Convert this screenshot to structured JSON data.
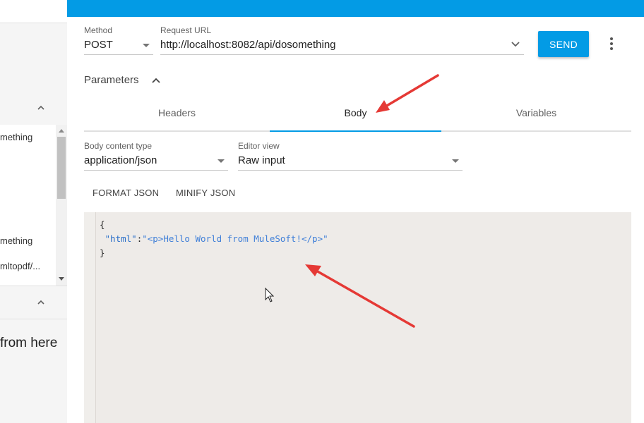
{
  "sidebar": {
    "items": [
      "mething",
      "mething",
      "mltopdf/..."
    ],
    "promo_text": "from here"
  },
  "request": {
    "method_label": "Method",
    "method_value": "POST",
    "url_label": "Request URL",
    "url_value": "http://localhost:8082/api/dosomething",
    "send_label": "SEND"
  },
  "parameters": {
    "title": "Parameters",
    "tabs": [
      {
        "label": "Headers",
        "active": false
      },
      {
        "label": "Body",
        "active": true
      },
      {
        "label": "Variables",
        "active": false
      }
    ]
  },
  "body": {
    "content_type_label": "Body content type",
    "content_type_value": "application/json",
    "editor_view_label": "Editor view",
    "editor_view_value": "Raw input",
    "format_label": "FORMAT JSON",
    "minify_label": "MINIFY JSON",
    "code": {
      "open": "{",
      "key": "\"html\"",
      "colon": ":",
      "value": "\"<p>Hello World from MuleSoft!</p>\"",
      "close": "}"
    }
  },
  "colors": {
    "accent": "#039be5",
    "annotation_arrow": "#e53935"
  },
  "icons": {
    "chevron_up": "chevron-up-icon",
    "dropdown": "dropdown-arrow-icon",
    "more": "more-vert-icon",
    "cursor": "mouse-pointer-icon"
  }
}
